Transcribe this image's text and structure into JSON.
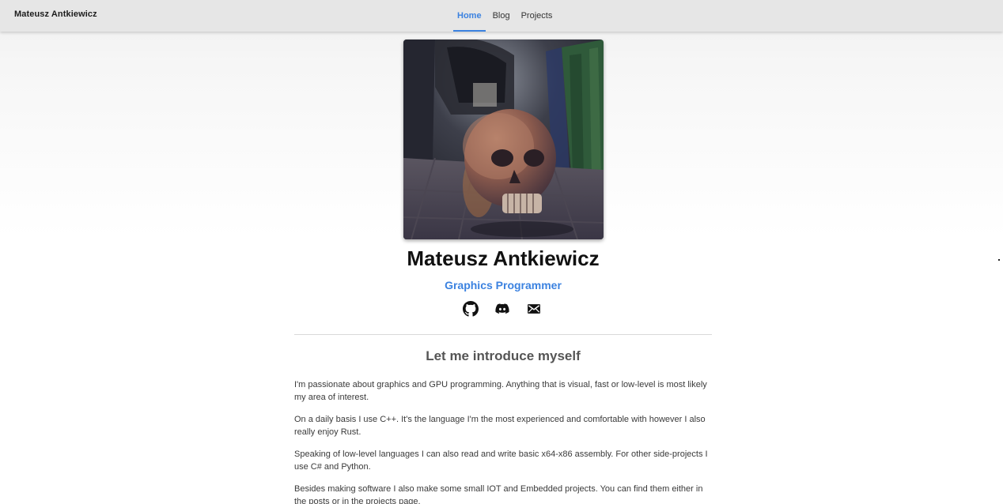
{
  "nav": {
    "brand": "Mateusz Antkiewicz",
    "links": [
      {
        "label": "Home",
        "active": true
      },
      {
        "label": "Blog",
        "active": false
      },
      {
        "label": "Projects",
        "active": false
      }
    ]
  },
  "profile": {
    "name": "Mateusz Antkiewicz",
    "role": "Graphics Programmer",
    "avatar_subject": "rendered skull in a stone hallway",
    "socials": [
      "github-icon",
      "discord-icon",
      "email-icon"
    ]
  },
  "intro": {
    "title": "Let me introduce myself",
    "paragraphs": [
      "I'm passionate about graphics and GPU programming. Anything that is visual, fast or low-level is most likely my area of interest.",
      "On a daily basis I use C++. It's the language I'm the most experienced and comfortable with however I also really enjoy Rust.",
      "Speaking of low-level languages I can also read and write basic x64-x86 assembly. For other side-projects I use C# and Python.",
      "Besides making software I also make some small IOT and Embedded projects. You can find them either in the posts or in the projects page."
    ]
  },
  "colors": {
    "accent": "#3b82e0",
    "navbar": "#e6e6e6",
    "heading": "#111111",
    "body_text": "#3a3a3a"
  }
}
